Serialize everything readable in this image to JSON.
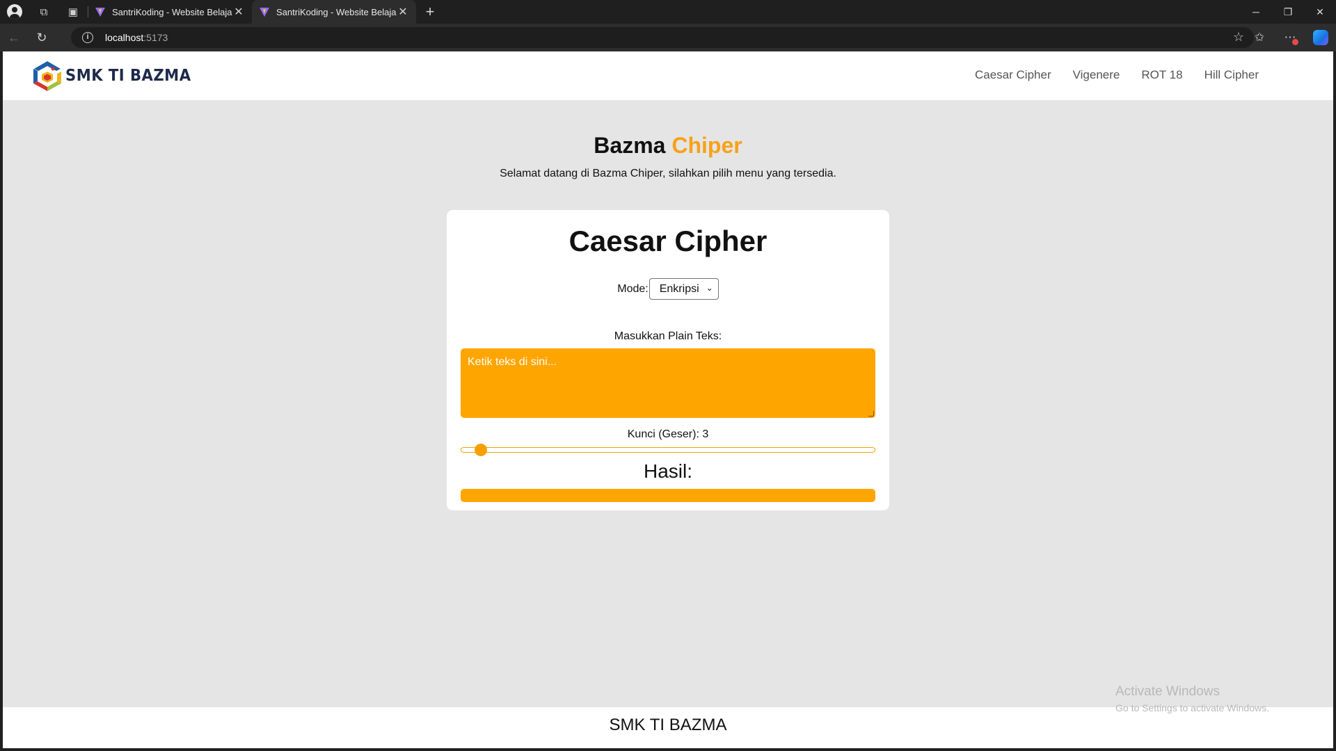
{
  "browser": {
    "tabs": [
      {
        "title": "SantriKoding - Website Belajar Coding",
        "active": false
      },
      {
        "title": "SantriKoding - Website Belajar Coding",
        "active": true
      }
    ],
    "url_host": "localhost",
    "url_port": ":5173",
    "icons": {
      "tab_actions": [
        "profile-icon",
        "workspaces-icon",
        "vertical-tabs-icon"
      ],
      "nav": [
        "back-icon",
        "refresh-icon"
      ],
      "address": [
        "site-info-icon",
        "favorite-star-icon"
      ],
      "tools": [
        "favorites-icon",
        "extensions-icon",
        "copilot-icon"
      ],
      "window": [
        "minimize-icon",
        "restore-icon",
        "close-icon"
      ]
    }
  },
  "site": {
    "logo_text": "SMK TI BAZMA",
    "nav": [
      "Caesar Cipher",
      "Vigenere",
      "ROT 18",
      "Hill Cipher"
    ],
    "hero": {
      "title_main": "Bazma",
      "title_accent": "Chiper",
      "subtitle": "Selamat datang di Bazma Chiper, silahkan pilih menu yang tersedia."
    },
    "card": {
      "title": "Caesar Cipher",
      "mode_label": "Mode:",
      "mode_value": "Enkripsi",
      "input_label": "Masukkan Plain Teks:",
      "input_placeholder": "Ketik teks di sini...",
      "input_value": "",
      "key_label": "Kunci (Geser): 3",
      "key_value": 3,
      "key_min": 1,
      "key_max": 80,
      "result_label": "Hasil:",
      "result_value": ""
    },
    "footer": "SMK TI BAZMA"
  },
  "os_overlay": {
    "line1": "Activate Windows",
    "line2": "Go to Settings to activate Windows."
  },
  "colors": {
    "accent": "#ffa500",
    "title_accent": "#f6a219",
    "page_bg": "#e5e5e5"
  }
}
